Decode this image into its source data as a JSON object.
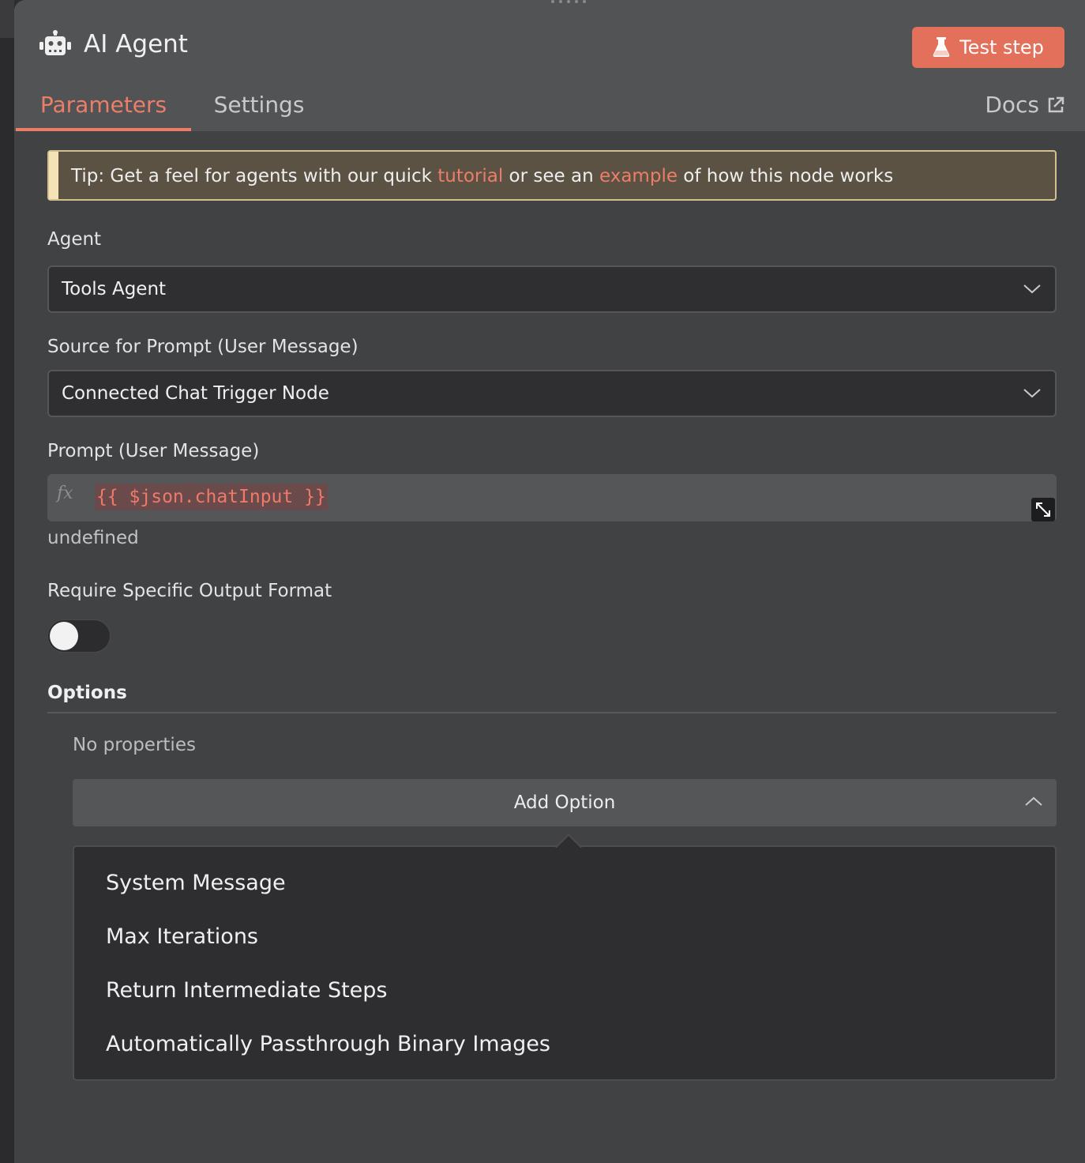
{
  "header": {
    "title": "AI Agent",
    "icon": "robot-icon",
    "test_button_label": "Test step",
    "test_button_icon": "flask-icon",
    "accent_color": "#e3705b"
  },
  "tabs": [
    {
      "label": "Parameters",
      "active": true
    },
    {
      "label": "Settings",
      "active": false
    }
  ],
  "docs": {
    "label": "Docs",
    "icon": "external-link-icon"
  },
  "tip": {
    "prefix": "Tip: Get a feel for agents with our quick ",
    "link1": "tutorial",
    "middle": " or see an ",
    "link2": "example",
    "suffix": " of how this node works"
  },
  "fields": {
    "agent": {
      "label": "Agent",
      "value": "Tools Agent"
    },
    "source": {
      "label": "Source for Prompt (User Message)",
      "value": "Connected Chat Trigger Node"
    },
    "prompt": {
      "label": "Prompt (User Message)",
      "fx": "fx",
      "expression": "{{ $json.chatInput }}",
      "hint": "undefined"
    },
    "output_format": {
      "label": "Require Specific Output Format",
      "enabled": false
    }
  },
  "options": {
    "title": "Options",
    "empty_text": "No properties",
    "add_label": "Add Option",
    "menu": [
      "System Message",
      "Max Iterations",
      "Return Intermediate Steps",
      "Automatically Passthrough Binary Images"
    ]
  }
}
